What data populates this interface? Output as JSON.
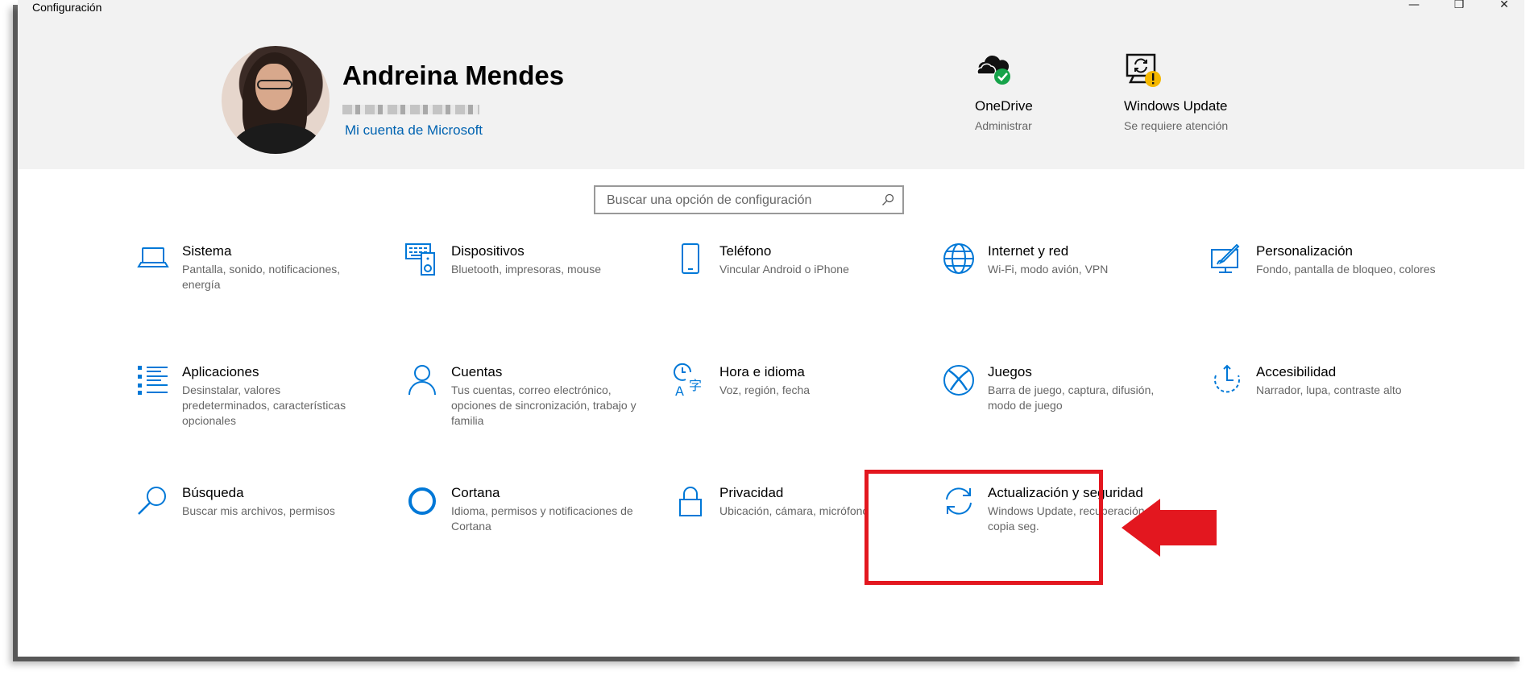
{
  "window": {
    "title": "Configuración",
    "controls": {
      "minimize": "—",
      "maximize": "❐",
      "close": "✕"
    }
  },
  "account": {
    "name": "Andreina Mendes",
    "link": "Mi cuenta de Microsoft"
  },
  "quick_links": [
    {
      "title": "OneDrive",
      "subtitle": "Administrar",
      "icon": "onedrive-cloud-icon"
    },
    {
      "title": "Windows Update",
      "subtitle": "Se requiere atención",
      "icon": "windows-update-icon"
    }
  ],
  "search": {
    "placeholder": "Buscar una opción de configuración"
  },
  "tiles": [
    {
      "title": "Sistema",
      "desc": "Pantalla, sonido, notificaciones, energía",
      "icon": "laptop-icon"
    },
    {
      "title": "Dispositivos",
      "desc": "Bluetooth, impresoras, mouse",
      "icon": "devices-icon"
    },
    {
      "title": "Teléfono",
      "desc": "Vincular Android o iPhone",
      "icon": "phone-icon"
    },
    {
      "title": "Internet y red",
      "desc": "Wi-Fi, modo avión, VPN",
      "icon": "globe-icon"
    },
    {
      "title": "Personalización",
      "desc": "Fondo, pantalla de bloqueo, colores",
      "icon": "personalization-icon"
    },
    {
      "title": "Aplicaciones",
      "desc": "Desinstalar, valores predeterminados, características opcionales",
      "icon": "apps-list-icon"
    },
    {
      "title": "Cuentas",
      "desc": "Tus cuentas, correo electrónico, opciones de sincronización, trabajo y familia",
      "icon": "person-icon"
    },
    {
      "title": "Hora e idioma",
      "desc": "Voz, región, fecha",
      "icon": "time-language-icon"
    },
    {
      "title": "Juegos",
      "desc": "Barra de juego, captura, difusión, modo de juego",
      "icon": "xbox-icon"
    },
    {
      "title": "Accesibilidad",
      "desc": "Narrador, lupa, contraste alto",
      "icon": "accessibility-icon"
    },
    {
      "title": "Búsqueda",
      "desc": "Buscar mis archivos, permisos",
      "icon": "search-icon"
    },
    {
      "title": "Cortana",
      "desc": "Idioma, permisos y notificaciones de Cortana",
      "icon": "cortana-icon"
    },
    {
      "title": "Privacidad",
      "desc": "Ubicación, cámara, micrófono",
      "icon": "lock-icon"
    },
    {
      "title": "Actualización y seguridad",
      "desc": "Windows Update, recuperación, copia seg.",
      "icon": "sync-arrows-icon"
    }
  ],
  "colors": {
    "accent": "#0078d7",
    "link": "#0063b1",
    "header_band": "#f2f2f2",
    "highlight": "#e3171f",
    "success": "#16a34a",
    "warning": "#f5b800"
  }
}
